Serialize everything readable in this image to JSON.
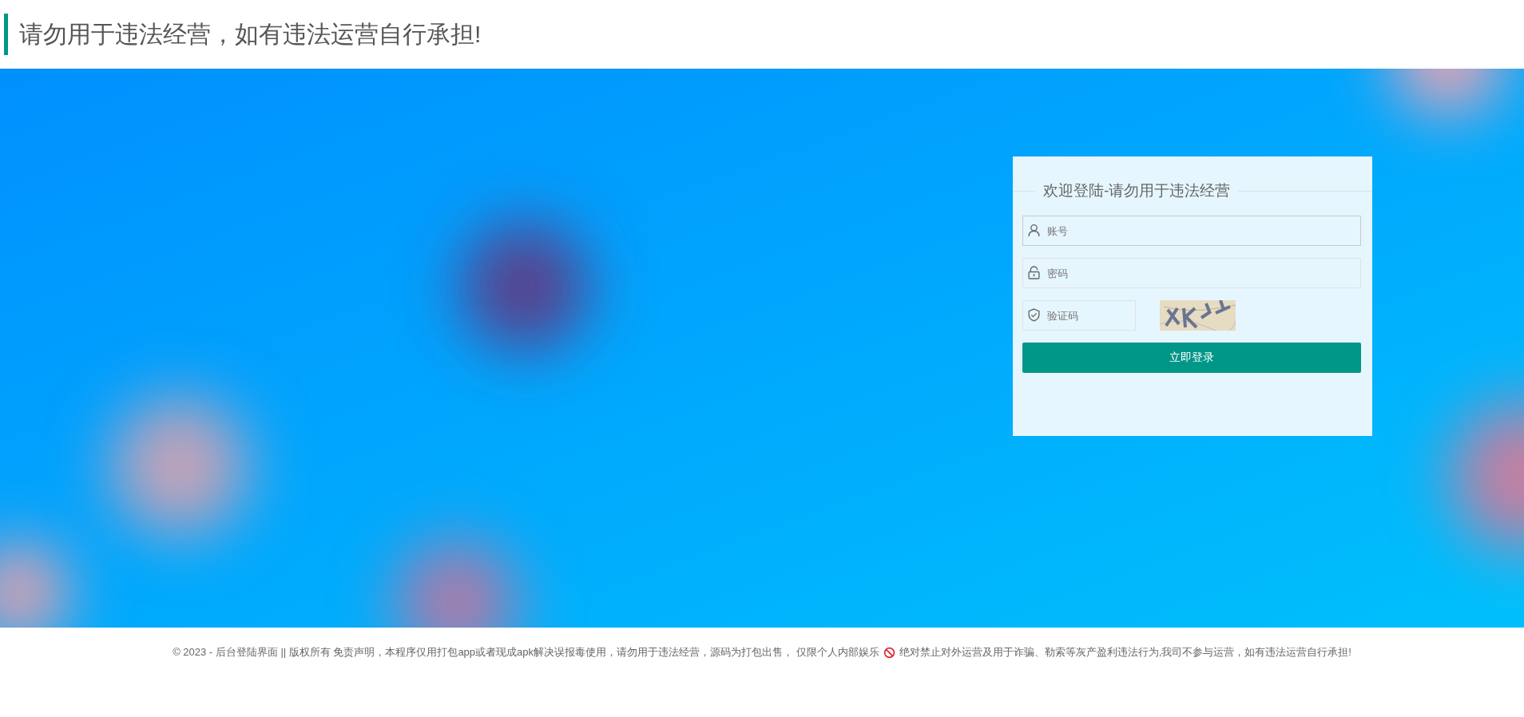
{
  "header": {
    "title": "请勿用于违法经营，如有违法运营自行承担!"
  },
  "login": {
    "legend": "欢迎登陆-请勿用于违法经营",
    "fields": [
      {
        "kind": "account",
        "placeholder": "账号"
      },
      {
        "kind": "password",
        "placeholder": "密码"
      },
      {
        "kind": "captcha",
        "placeholder": "验证码"
      }
    ],
    "submit": "立即登录"
  },
  "footer": {
    "text_before": "© 2023 - 后台登陆界面 || 版权所有 免责声明，本程序仅用打包app或者现成apk解决误报毒使用，请勿用于违法经营，源码为打包出售， 仅限个人内部娱乐",
    "text_after": "绝对禁止对外运营及用于诈骗、勒索等灰产盈利违法行为,我司不参与运营，如有违法运营自行承担!"
  }
}
